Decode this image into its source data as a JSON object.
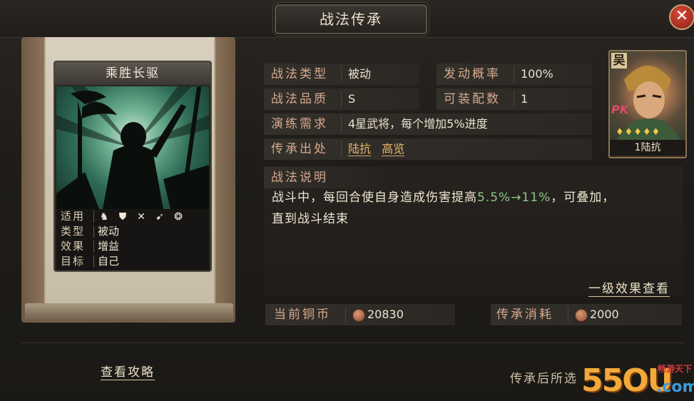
{
  "header": {
    "title": "战法传承",
    "close_label": "✕"
  },
  "card": {
    "title": "乘胜长驱",
    "rows": [
      {
        "key": "适用",
        "value": ""
      },
      {
        "key": "类型",
        "value": "被动"
      },
      {
        "key": "效果",
        "value": "增益"
      },
      {
        "key": "目标",
        "value": "自己"
      }
    ],
    "weapon_icons": [
      "cavalry-icon",
      "shield-icon",
      "bow-icon",
      "spear-icon",
      "wheel-icon"
    ]
  },
  "details": {
    "type_label": "战法类型",
    "type_value": "被动",
    "rate_label": "发动概率",
    "rate_value": "100%",
    "quality_label": "战法品质",
    "quality_value": "S",
    "equip_label": "可装配数",
    "equip_value": "1",
    "train_label": "演练需求",
    "train_value": "4星武将，每个增加5%进度",
    "source_label": "传承出处",
    "source_links": [
      "陆抗",
      "高览"
    ],
    "desc_label": "战法说明",
    "desc_part1": "战斗中，每回合使自身造成伤害提高",
    "desc_highlight": "5.5%→11%",
    "desc_part2": "，可叠加，",
    "desc_line2": "直到战斗结束",
    "level_effects_link": "一级效果查看"
  },
  "costs": {
    "current_coins_label": "当前铜币",
    "current_coins_value": "20830",
    "inherit_cost_label": "传承消耗",
    "inherit_cost_value": "2000"
  },
  "general": {
    "faction": "吴",
    "pk_badge": "PK",
    "name": "1陆抗",
    "stars": "♦♦♦♦♦"
  },
  "footer": {
    "guide_link": "查看攻略",
    "note": "传承后所选"
  },
  "watermark": {
    "brand": "55OU",
    "dotcom": ".com",
    "tag": "畅游天下"
  },
  "colors": {
    "label": "#d7a98f",
    "highlight_green": "#8fc787",
    "link": "#e9b66e"
  }
}
